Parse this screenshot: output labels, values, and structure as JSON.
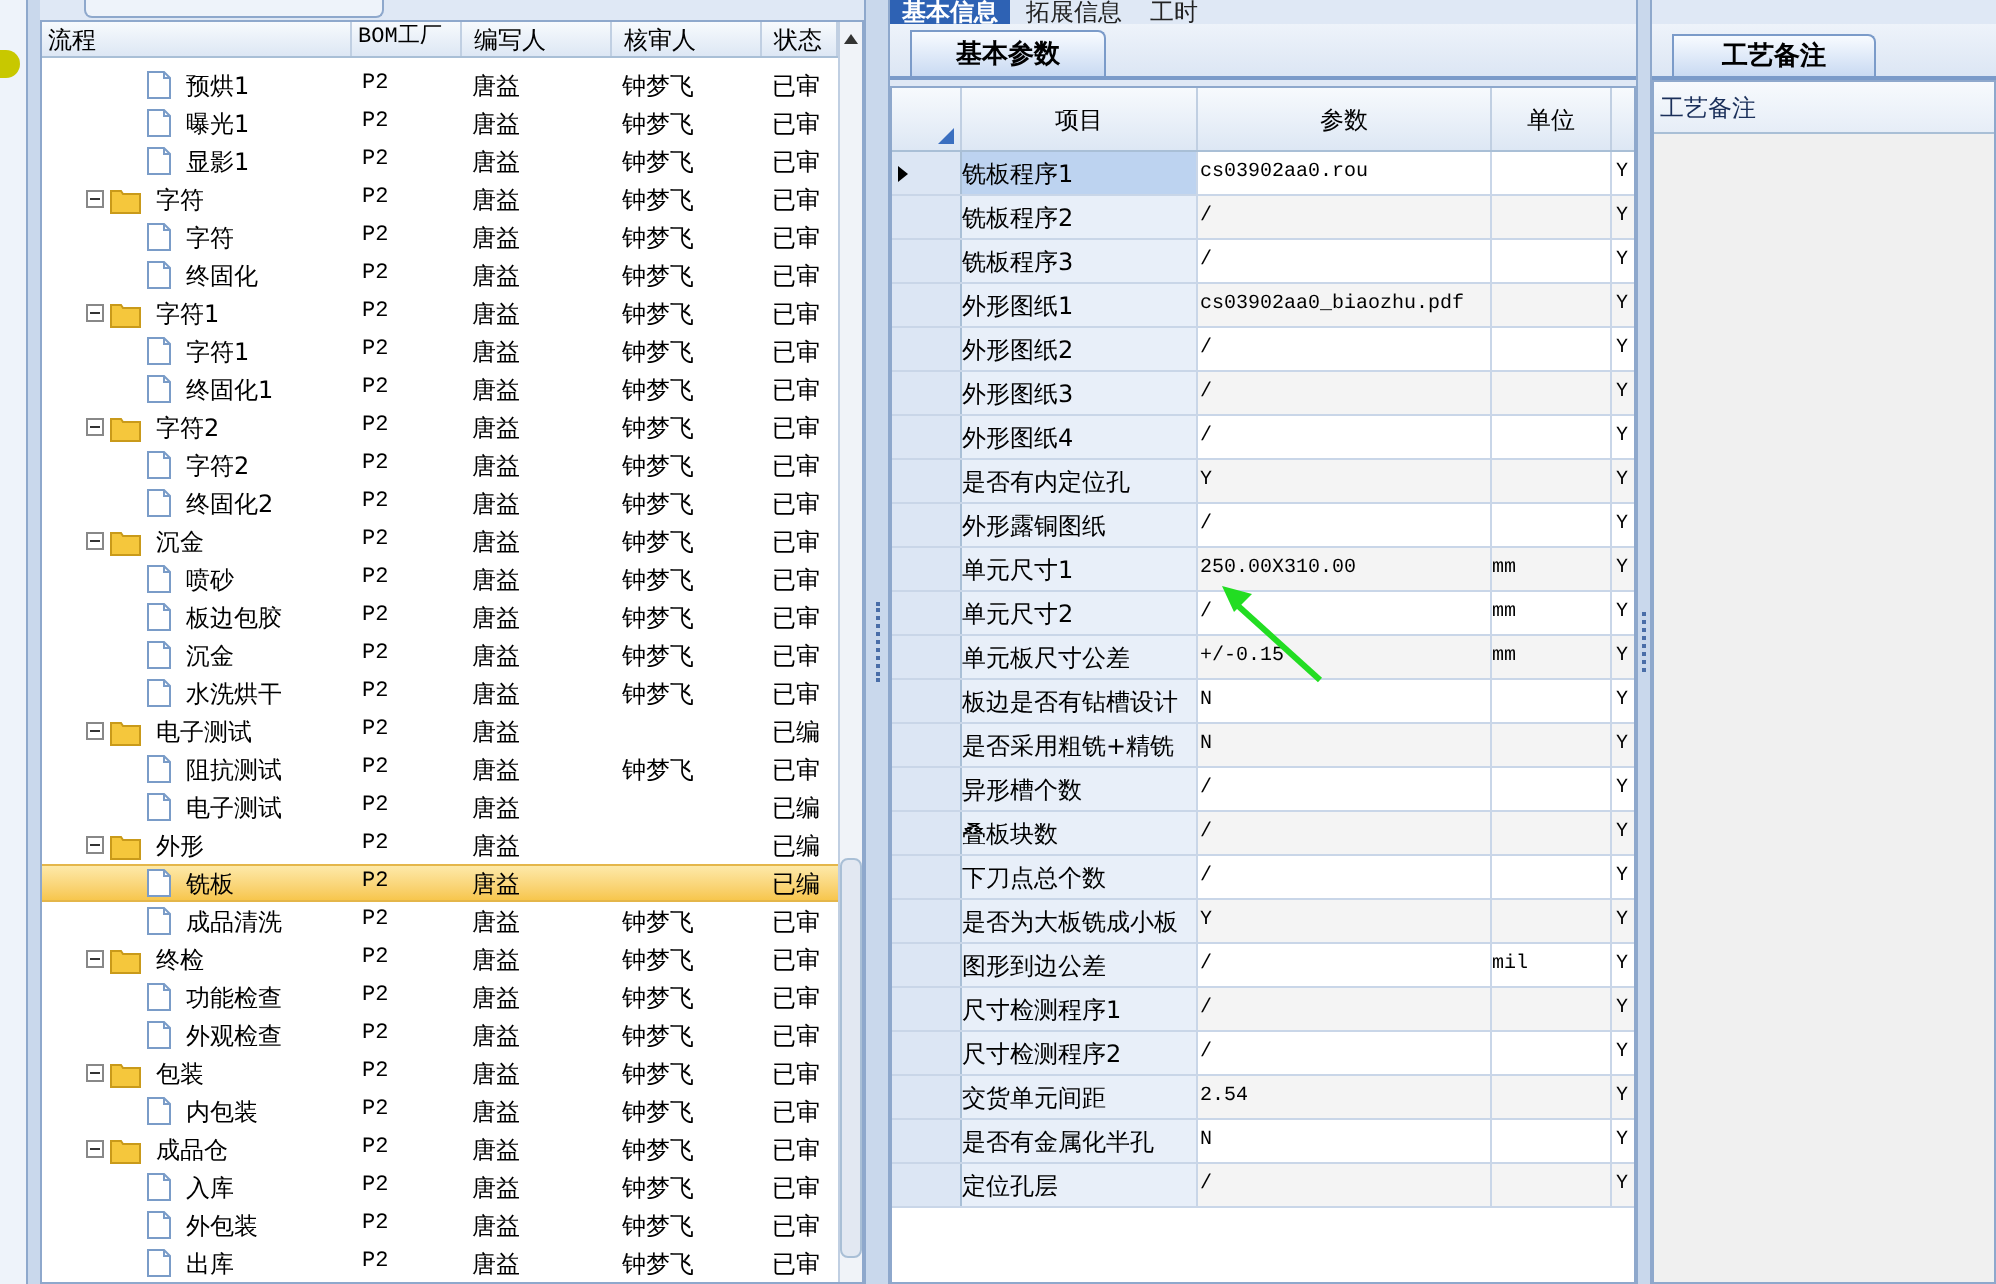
{
  "tree_grid": {
    "columns": [
      "流程",
      "BOM工厂",
      "编写人",
      "核审人",
      "状态"
    ],
    "nodes": [
      {
        "kind": "file",
        "name": "预烘1",
        "bom": "P2",
        "writer": "唐益",
        "reviewer": "钟梦飞",
        "status": "已审",
        "selected": false
      },
      {
        "kind": "file",
        "name": "曝光1",
        "bom": "P2",
        "writer": "唐益",
        "reviewer": "钟梦飞",
        "status": "已审",
        "selected": false
      },
      {
        "kind": "file",
        "name": "显影1",
        "bom": "P2",
        "writer": "唐益",
        "reviewer": "钟梦飞",
        "status": "已审",
        "selected": false
      },
      {
        "kind": "folder",
        "expanded": true,
        "name": "字符",
        "bom": "P2",
        "writer": "唐益",
        "reviewer": "钟梦飞",
        "status": "已审",
        "selected": false,
        "children": [
          {
            "kind": "file",
            "name": "字符",
            "bom": "P2",
            "writer": "唐益",
            "reviewer": "钟梦飞",
            "status": "已审",
            "selected": false
          },
          {
            "kind": "file",
            "name": "终固化",
            "bom": "P2",
            "writer": "唐益",
            "reviewer": "钟梦飞",
            "status": "已审",
            "selected": false
          }
        ]
      },
      {
        "kind": "folder",
        "expanded": true,
        "name": "字符1",
        "bom": "P2",
        "writer": "唐益",
        "reviewer": "钟梦飞",
        "status": "已审",
        "selected": false,
        "children": [
          {
            "kind": "file",
            "name": "字符1",
            "bom": "P2",
            "writer": "唐益",
            "reviewer": "钟梦飞",
            "status": "已审",
            "selected": false
          },
          {
            "kind": "file",
            "name": "终固化1",
            "bom": "P2",
            "writer": "唐益",
            "reviewer": "钟梦飞",
            "status": "已审",
            "selected": false
          }
        ]
      },
      {
        "kind": "folder",
        "expanded": true,
        "name": "字符2",
        "bom": "P2",
        "writer": "唐益",
        "reviewer": "钟梦飞",
        "status": "已审",
        "selected": false,
        "children": [
          {
            "kind": "file",
            "name": "字符2",
            "bom": "P2",
            "writer": "唐益",
            "reviewer": "钟梦飞",
            "status": "已审",
            "selected": false
          },
          {
            "kind": "file",
            "name": "终固化2",
            "bom": "P2",
            "writer": "唐益",
            "reviewer": "钟梦飞",
            "status": "已审",
            "selected": false
          }
        ]
      },
      {
        "kind": "folder",
        "expanded": true,
        "name": "沉金",
        "bom": "P2",
        "writer": "唐益",
        "reviewer": "钟梦飞",
        "status": "已审",
        "selected": false,
        "children": [
          {
            "kind": "file",
            "name": "喷砂",
            "bom": "P2",
            "writer": "唐益",
            "reviewer": "钟梦飞",
            "status": "已审",
            "selected": false
          },
          {
            "kind": "file",
            "name": "板边包胶",
            "bom": "P2",
            "writer": "唐益",
            "reviewer": "钟梦飞",
            "status": "已审",
            "selected": false
          },
          {
            "kind": "file",
            "name": "沉金",
            "bom": "P2",
            "writer": "唐益",
            "reviewer": "钟梦飞",
            "status": "已审",
            "selected": false
          },
          {
            "kind": "file",
            "name": "水洗烘干",
            "bom": "P2",
            "writer": "唐益",
            "reviewer": "钟梦飞",
            "status": "已审",
            "selected": false
          }
        ]
      },
      {
        "kind": "folder",
        "expanded": true,
        "name": "电子测试",
        "bom": "P2",
        "writer": "唐益",
        "status": "已编",
        "selected": false,
        "children": [
          {
            "kind": "file",
            "name": "阻抗测试",
            "bom": "P2",
            "writer": "唐益",
            "reviewer": "钟梦飞",
            "status": "已审",
            "selected": false
          },
          {
            "kind": "file",
            "name": "电子测试",
            "bom": "P2",
            "writer": "唐益",
            "status": "已编",
            "selected": false
          }
        ]
      },
      {
        "kind": "folder",
        "expanded": true,
        "name": "外形",
        "bom": "P2",
        "writer": "唐益",
        "status": "已编",
        "selected": false,
        "children": [
          {
            "kind": "file",
            "name": "铣板",
            "bom": "P2",
            "writer": "唐益",
            "status": "已编",
            "selected": true
          },
          {
            "kind": "file",
            "name": "成品清洗",
            "bom": "P2",
            "writer": "唐益",
            "reviewer": "钟梦飞",
            "status": "已审",
            "selected": false
          }
        ]
      },
      {
        "kind": "folder",
        "expanded": true,
        "name": "终检",
        "bom": "P2",
        "writer": "唐益",
        "reviewer": "钟梦飞",
        "status": "已审",
        "selected": false,
        "children": [
          {
            "kind": "file",
            "name": "功能检查",
            "bom": "P2",
            "writer": "唐益",
            "reviewer": "钟梦飞",
            "status": "已审",
            "selected": false
          },
          {
            "kind": "file",
            "name": "外观检查",
            "bom": "P2",
            "writer": "唐益",
            "reviewer": "钟梦飞",
            "status": "已审",
            "selected": false
          }
        ]
      },
      {
        "kind": "folder",
        "expanded": true,
        "name": "包装",
        "bom": "P2",
        "writer": "唐益",
        "reviewer": "钟梦飞",
        "status": "已审",
        "selected": false,
        "children": [
          {
            "kind": "file",
            "name": "内包装",
            "bom": "P2",
            "writer": "唐益",
            "reviewer": "钟梦飞",
            "status": "已审",
            "selected": false
          }
        ]
      },
      {
        "kind": "folder",
        "expanded": true,
        "name": "成品仓",
        "bom": "P2",
        "writer": "唐益",
        "reviewer": "钟梦飞",
        "status": "已审",
        "selected": false,
        "children": [
          {
            "kind": "file",
            "name": "入库",
            "bom": "P2",
            "writer": "唐益",
            "reviewer": "钟梦飞",
            "status": "已审",
            "selected": false
          },
          {
            "kind": "file",
            "name": "外包装",
            "bom": "P2",
            "writer": "唐益",
            "reviewer": "钟梦飞",
            "status": "已审",
            "selected": false
          },
          {
            "kind": "file",
            "name": "出库",
            "bom": "P2",
            "writer": "唐益",
            "reviewer": "钟梦飞",
            "status": "已审",
            "selected": false
          }
        ]
      }
    ]
  },
  "top_tabs": [
    {
      "label": "基本信息",
      "selected": true
    },
    {
      "label": "拓展信息",
      "selected": false
    },
    {
      "label": "工时",
      "selected": false
    }
  ],
  "sub_tab": {
    "label": "基本参数",
    "selected": true
  },
  "param_grid": {
    "columns": [
      "项目",
      "参数",
      "单位"
    ],
    "rows": [
      {
        "item": "铣板程序1",
        "value": "cs03902aa0.rou",
        "column_4": "Y",
        "selected": true
      },
      {
        "item": "铣板程序2",
        "value": "/",
        "column_4": "Y",
        "selected": false
      },
      {
        "item": "铣板程序3",
        "value": "/",
        "column_4": "Y",
        "selected": false
      },
      {
        "item": "外形图纸1",
        "value": "cs03902aa0_biaozhu.pdf",
        "column_4": "Y",
        "selected": false
      },
      {
        "item": "外形图纸2",
        "value": "/",
        "column_4": "Y",
        "selected": false
      },
      {
        "item": "外形图纸3",
        "value": "/",
        "column_4": "Y",
        "selected": false
      },
      {
        "item": "外形图纸4",
        "value": "/",
        "column_4": "Y",
        "selected": false
      },
      {
        "item": "是否有内定位孔",
        "value": "Y",
        "column_4": "Y",
        "selected": false
      },
      {
        "item": "外形露铜图纸",
        "value": "/",
        "column_4": "Y",
        "selected": false
      },
      {
        "item": "单元尺寸1",
        "value": "250.00X310.00",
        "unit": "mm",
        "column_4": "Y",
        "selected": false
      },
      {
        "item": "单元尺寸2",
        "value": "/",
        "unit": "mm",
        "column_4": "Y",
        "selected": false
      },
      {
        "item": "单元板尺寸公差",
        "value": "+/-0.15",
        "unit": "mm",
        "column_4": "Y",
        "selected": false
      },
      {
        "item": "板边是否有钻槽设计",
        "value": "N",
        "column_4": "Y",
        "selected": false
      },
      {
        "item": "是否采用粗铣+精铣",
        "value": "N",
        "column_4": "Y",
        "selected": false
      },
      {
        "item": "异形槽个数",
        "value": "/",
        "column_4": "Y",
        "selected": false
      },
      {
        "item": "叠板块数",
        "value": "/",
        "column_4": "Y",
        "selected": false
      },
      {
        "item": "下刀点总个数",
        "value": "/",
        "column_4": "Y",
        "selected": false
      },
      {
        "item": "是否为大板铣成小板",
        "value": "Y",
        "column_4": "Y",
        "selected": false
      },
      {
        "item": "图形到边公差",
        "value": "/",
        "unit": "mil",
        "column_4": "Y",
        "selected": false
      },
      {
        "item": "尺寸检测程序1",
        "value": "/",
        "column_4": "Y",
        "selected": false
      },
      {
        "item": "尺寸检测程序2",
        "value": "/",
        "column_4": "Y",
        "selected": false
      },
      {
        "item": "交货单元间距",
        "value": "2.54",
        "column_4": "Y",
        "selected": false
      },
      {
        "item": "是否有金属化半孔",
        "value": "N",
        "column_4": "Y",
        "selected": false
      },
      {
        "item": "定位孔层",
        "value": "/",
        "column_4": "Y",
        "selected": false
      }
    ]
  },
  "notes_panel": {
    "tab": "工艺备注",
    "header": "工艺备注"
  }
}
